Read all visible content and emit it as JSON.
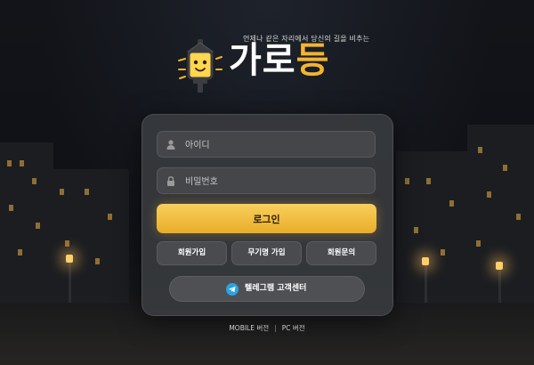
{
  "brand": {
    "tagline": "언제나 같은 자리에서 당신의 길을 비추는",
    "name_main": "가로",
    "name_highlight": "등",
    "accent_color": "#f4b431"
  },
  "login_form": {
    "username_placeholder": "아이디",
    "password_placeholder": "비밀번호",
    "username_icon": "user-icon",
    "password_icon": "lock-icon",
    "login_label": "로그인"
  },
  "actions": {
    "signup_label": "회원가입",
    "anonymous_signup_label": "무기명 가입",
    "member_inquiry_label": "회원문의",
    "telegram_label": "텔레그램 고객센터",
    "telegram_icon": "telegram-icon"
  },
  "footer": {
    "mobile_label": "MOBILE 버전",
    "separator": "|",
    "pc_label": "PC 버전"
  }
}
